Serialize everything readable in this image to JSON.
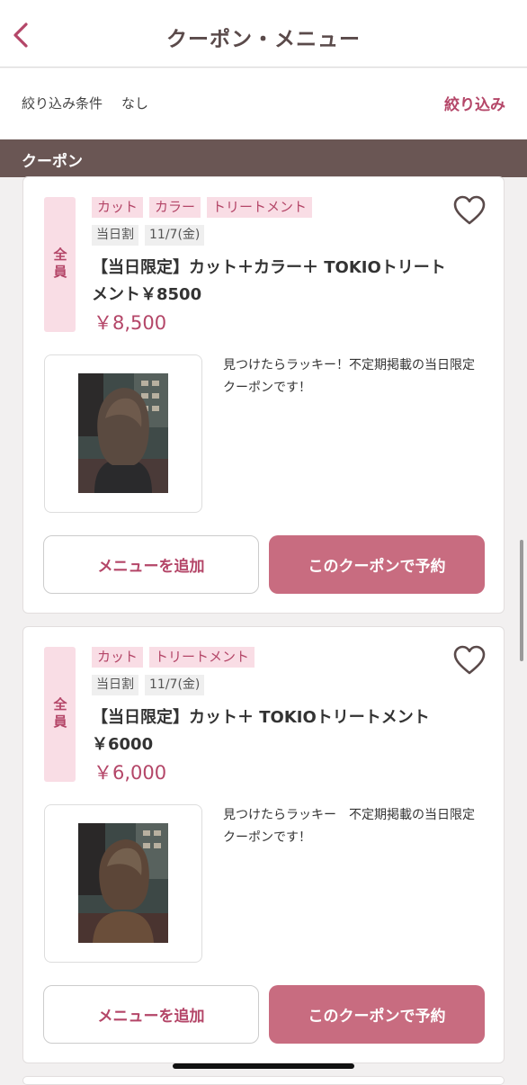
{
  "header": {
    "title": "クーポン・メニュー",
    "back_icon": "chevron-left-icon"
  },
  "filter": {
    "label": "絞り込み条件",
    "value": "なし",
    "action_label": "絞り込み"
  },
  "section": {
    "title": "クーポン"
  },
  "colors": {
    "accent": "#b44668",
    "button": "#c86c80",
    "section_bg": "#6a5654",
    "tag_bg": "#f9dde5"
  },
  "coupons": [
    {
      "target": "全員",
      "tags": [
        "カット",
        "カラー",
        "トリートメント"
      ],
      "chips": [
        "当日割",
        "11/7(金)"
      ],
      "name": "【当日限定】カット＋カラー＋ TOKIOトリートメント￥8500",
      "price": "￥8,500",
      "description": "見つけたらラッキー！不定期掲載の当日限定クーポンです！",
      "add_label": "メニューを追加",
      "reserve_label": "このクーポンで予約",
      "favorite_icon": "heart-outline-icon"
    },
    {
      "target": "全員",
      "tags": [
        "カット",
        "トリートメント"
      ],
      "chips": [
        "当日割",
        "11/7(金)"
      ],
      "name": "【当日限定】カット＋ TOKIOトリートメント￥6000",
      "price": "￥6,000",
      "description": "見つけたらラッキー　不定期掲載の当日限定クーポンです！",
      "add_label": "メニューを追加",
      "reserve_label": "このクーポンで予約",
      "favorite_icon": "heart-outline-icon"
    }
  ]
}
